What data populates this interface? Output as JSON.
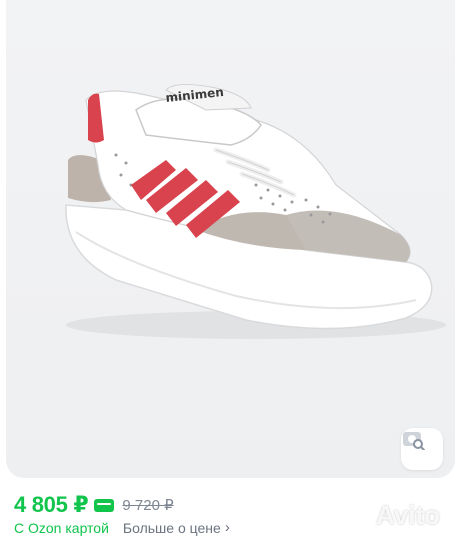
{
  "product": {
    "image_alt": "Детские кеды белые с красными полосками",
    "logo_text": "minimen"
  },
  "price": {
    "current": "4 805 ₽",
    "old": "9 720 ₽",
    "card_label": "С Ozon картой",
    "more_label": "Больше о цене"
  },
  "icons": {
    "search_by_photo": "camera-search-icon",
    "card_badge": "ozon-card-icon",
    "chevron": "chevron-right-icon"
  },
  "watermark": {
    "text": "Avito"
  },
  "colors": {
    "price_green": "#10c44c",
    "muted": "#7e8792",
    "stripe_red": "#d8434d",
    "suede_grey": "#b9b0a8"
  }
}
